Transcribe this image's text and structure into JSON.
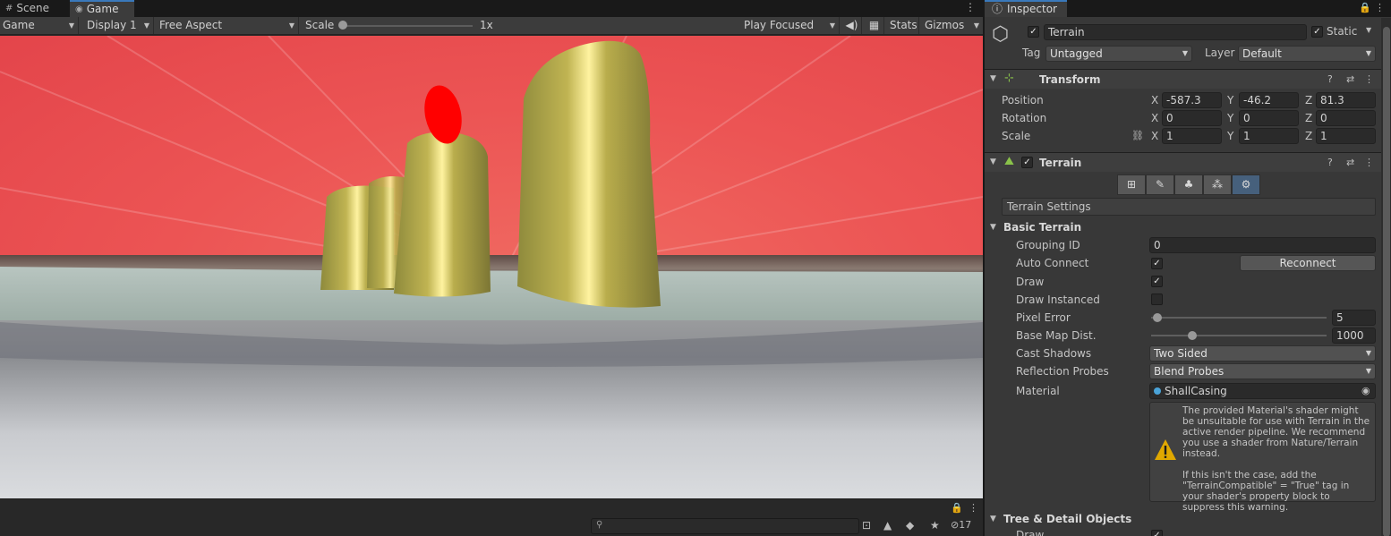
{
  "left_tabs": {
    "scene": "Scene",
    "game": "Game"
  },
  "toolbar": {
    "game_view": "Game",
    "display": "Display 1",
    "aspect": "Free Aspect",
    "scale_label": "Scale",
    "scale_value": "1x",
    "scale_level": 0,
    "play_mode": "Play Focused",
    "stats": "Stats",
    "gizmos": "Gizmos"
  },
  "bottombar": {
    "hidden_count": "17"
  },
  "inspector": {
    "tab": "Inspector",
    "object_name": "Terrain",
    "static_label": "Static",
    "tag_label": "Tag",
    "tag_value": "Untagged",
    "layer_label": "Layer",
    "layer_value": "Default",
    "transform": {
      "title": "Transform",
      "position_label": "Position",
      "rotation_label": "Rotation",
      "scale_label": "Scale",
      "axes": {
        "x": "X",
        "y": "Y",
        "z": "Z"
      },
      "position": {
        "x": "-587.3",
        "y": "-46.2",
        "z": "81.3"
      },
      "rotation": {
        "x": "0",
        "y": "0",
        "z": "0"
      },
      "scale": {
        "x": "1",
        "y": "1",
        "z": "1"
      }
    },
    "terrain": {
      "title": "Terrain",
      "settings_header": "Terrain Settings",
      "basic_header": "Basic Terrain",
      "grouping_id_label": "Grouping ID",
      "grouping_id": "0",
      "auto_connect_label": "Auto Connect",
      "reconnect_button": "Reconnect",
      "draw_label": "Draw",
      "draw_instanced_label": "Draw Instanced",
      "pixel_error_label": "Pixel Error",
      "pixel_error": "5",
      "base_map_label": "Base Map Dist.",
      "base_map": "1000",
      "cast_shadows_label": "Cast Shadows",
      "cast_shadows": "Two Sided",
      "reflection_probes_label": "Reflection Probes",
      "reflection_probes": "Blend Probes",
      "material_label": "Material",
      "material": "ShallCasing",
      "warning": "The provided Material's shader might be unsuitable for use with Terrain in the active render pipeline. We recommend you use a shader from Nature/Terrain instead.\n\nIf this isn't the case, add the \"TerrainCompatible\" = \"True\" tag in your shader's property block to suppress this warning.",
      "tree_header": "Tree & Detail Objects",
      "draw_partial": "Draw"
    }
  },
  "colors": {
    "accent": "#3a79bb",
    "sky": "#ef5050",
    "marker": "#ff0000",
    "pillar": "#a9a247",
    "warning": "#e0a800"
  }
}
